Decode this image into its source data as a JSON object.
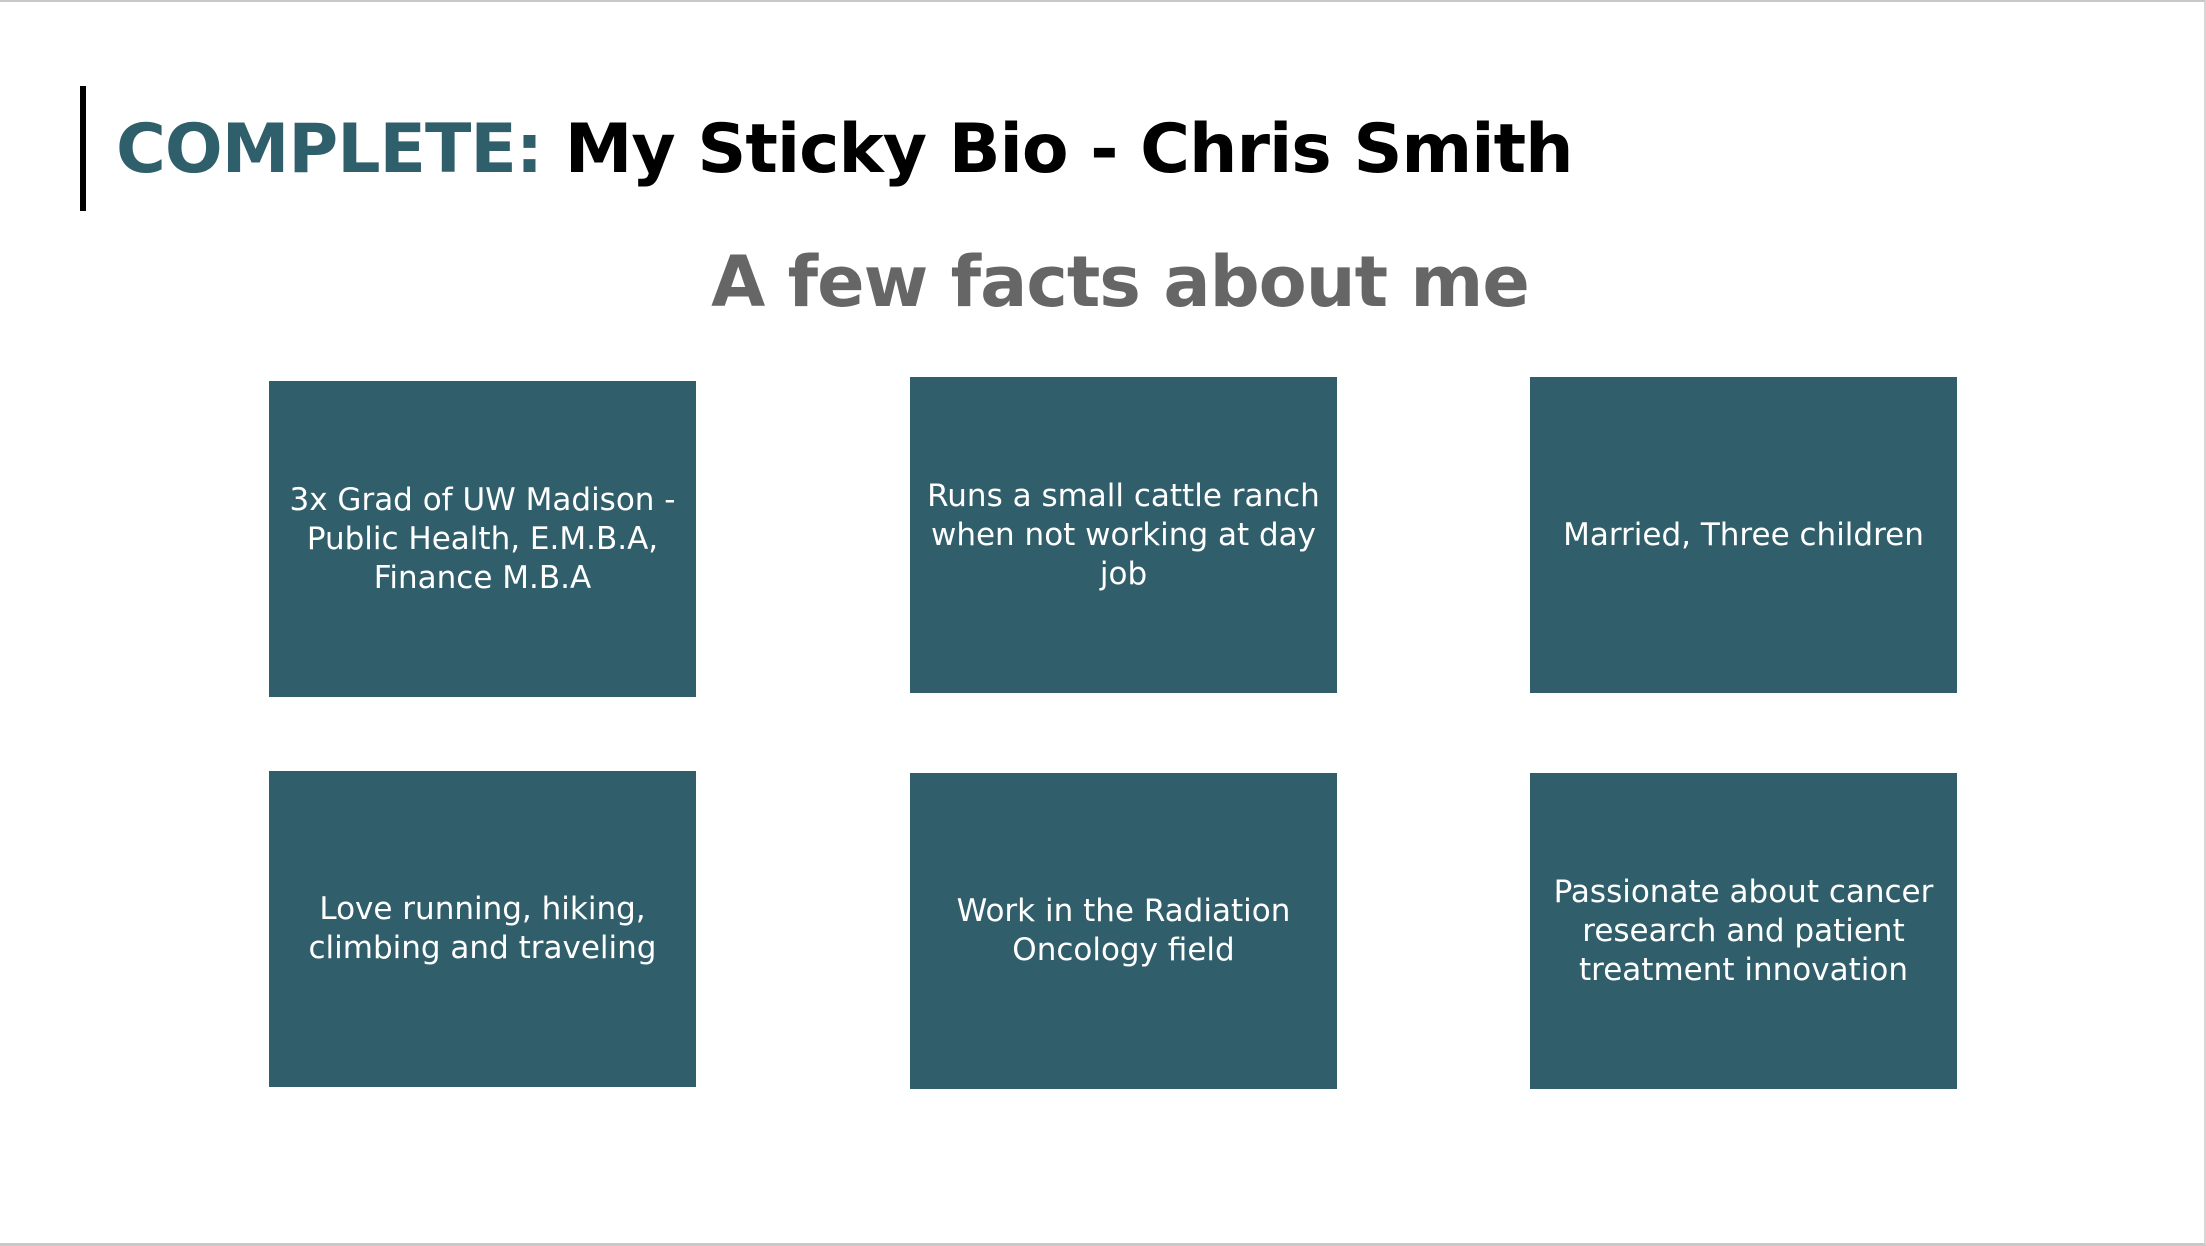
{
  "slide": {
    "title_prefix": "COMPLETE:",
    "title_rest": "My Sticky Bio - Chris Smith",
    "subtitle": "A few facts about me"
  },
  "cards": [
    {
      "text": "3x Grad of UW Madison - Public Health, E.M.B.A, Finance M.B.A"
    },
    {
      "text": "Runs a small cattle ranch when not working at day job"
    },
    {
      "text": "Married, Three children"
    },
    {
      "text": "Love running, hiking, climbing and traveling"
    },
    {
      "text": "Work in the Radiation Oncology field"
    },
    {
      "text": "Passionate about cancer research and patient treatment innovation"
    }
  ],
  "colors": {
    "accent": "#2f5f6b",
    "card_background": "#305f6b",
    "subtitle": "#666666",
    "title": "#000000"
  }
}
